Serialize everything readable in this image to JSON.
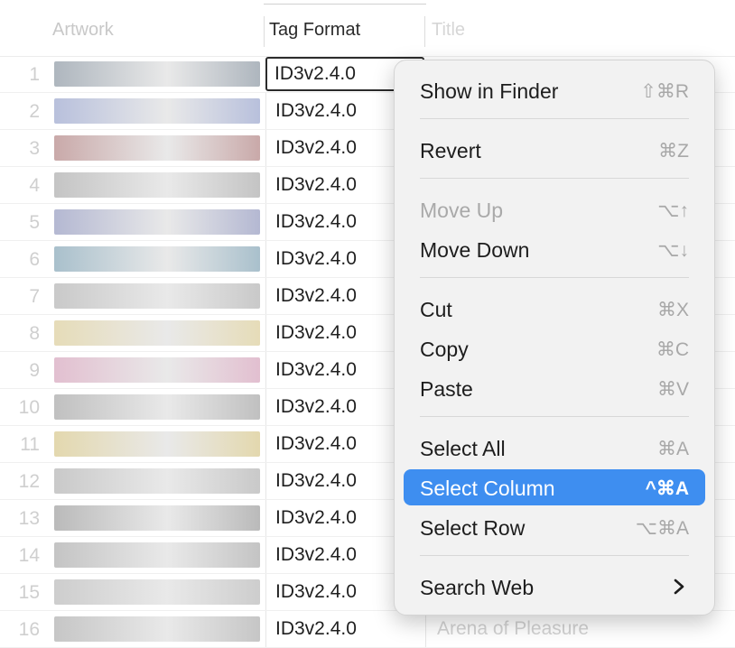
{
  "header": {
    "artwork": "Artwork",
    "tag_format": "Tag Format",
    "title": "Title"
  },
  "rows": [
    {
      "num": "1",
      "tag": "ID3v2.4.0",
      "title": "",
      "art": "#aeb6be"
    },
    {
      "num": "2",
      "tag": "ID3v2.4.0",
      "title": "",
      "art": "#b8c0dc"
    },
    {
      "num": "3",
      "tag": "ID3v2.4.0",
      "title": "",
      "art": "#c9a9a9"
    },
    {
      "num": "4",
      "tag": "ID3v2.4.0",
      "title": "",
      "art": "#c4c4c4"
    },
    {
      "num": "5",
      "tag": "ID3v2.4.0",
      "title": "",
      "art": "#b4b8d2"
    },
    {
      "num": "6",
      "tag": "ID3v2.4.0",
      "title": "",
      "art": "#a9c0cc"
    },
    {
      "num": "7",
      "tag": "ID3v2.4.0",
      "title": "",
      "art": "#c9c9c9"
    },
    {
      "num": "8",
      "tag": "ID3v2.4.0",
      "title": "",
      "art": "#e6dcb8"
    },
    {
      "num": "9",
      "tag": "ID3v2.4.0",
      "title": "",
      "art": "#e2bfd0"
    },
    {
      "num": "10",
      "tag": "ID3v2.4.0",
      "title": "",
      "art": "#c0c0c0"
    },
    {
      "num": "11",
      "tag": "ID3v2.4.0",
      "title": "",
      "art": "#e3d8ae"
    },
    {
      "num": "12",
      "tag": "ID3v2.4.0",
      "title": "",
      "art": "#c9c9c9"
    },
    {
      "num": "13",
      "tag": "ID3v2.4.0",
      "title": "",
      "art": "#bababa"
    },
    {
      "num": "14",
      "tag": "ID3v2.4.0",
      "title": "",
      "art": "#c4c4c4"
    },
    {
      "num": "15",
      "tag": "ID3v2.4.0",
      "title": "",
      "art": "#cdcdcd"
    },
    {
      "num": "16",
      "tag": "ID3v2.4.0",
      "title": "Arena of Pleasure",
      "art": "#c6c6c6"
    }
  ],
  "menu": {
    "show_in_finder": {
      "label": "Show in Finder",
      "shortcut": "⇧⌘R"
    },
    "revert": {
      "label": "Revert",
      "shortcut": "⌘Z"
    },
    "move_up": {
      "label": "Move Up",
      "shortcut": "⌥↑"
    },
    "move_down": {
      "label": "Move Down",
      "shortcut": "⌥↓"
    },
    "cut": {
      "label": "Cut",
      "shortcut": "⌘X"
    },
    "copy": {
      "label": "Copy",
      "shortcut": "⌘C"
    },
    "paste": {
      "label": "Paste",
      "shortcut": "⌘V"
    },
    "select_all": {
      "label": "Select All",
      "shortcut": "⌘A"
    },
    "select_column": {
      "label": "Select Column",
      "shortcut": "^⌘A"
    },
    "select_row": {
      "label": "Select Row",
      "shortcut": "⌥⌘A"
    },
    "search_web": {
      "label": "Search Web",
      "submenu_icon": "chevron-right-icon"
    }
  },
  "colors": {
    "selection": "#3e8ef0",
    "menu_bg": "#f2f2f2"
  }
}
